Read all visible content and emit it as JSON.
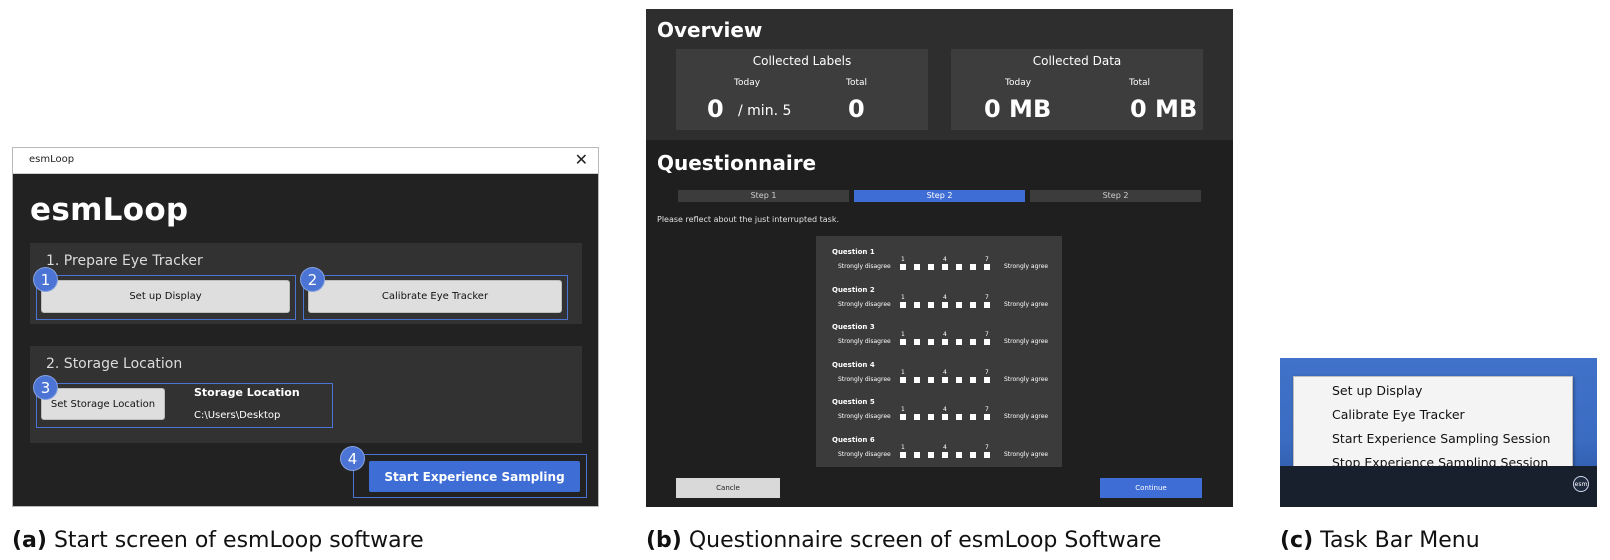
{
  "start_screen": {
    "window_title": "esmLoop",
    "close_glyph": "✕",
    "app_title": "esmLoop",
    "section1_title": "1. Prepare Eye Tracker",
    "setup_display_btn": "Set up Display",
    "calibrate_btn": "Calibrate Eye Tracker",
    "section2_title": "2. Storage Location",
    "set_storage_btn": "Set Storage Location",
    "storage_label": "Storage Location",
    "storage_path": "C:\\Users\\Desktop",
    "start_btn": "Start Experience Sampling",
    "badges": [
      "1",
      "2",
      "3",
      "4"
    ],
    "accent_color": "#4b74d4"
  },
  "questionnaire_screen": {
    "overview_title": "Overview",
    "labels_card": {
      "title": "Collected Labels",
      "today_label": "Today",
      "total_label": "Total",
      "today_value": "0",
      "today_suffix": "/ min. 5",
      "total_value": "0"
    },
    "data_card": {
      "title": "Collected Data",
      "today_label": "Today",
      "total_label": "Total",
      "today_value": "0 MB",
      "total_value": "0 MB"
    },
    "questionnaire_title": "Questionnaire",
    "steps": [
      "Step 1",
      "Step 2",
      "Step 2"
    ],
    "active_step_index": 1,
    "instruction": "Please reflect about the just interrupted task.",
    "questions": [
      {
        "title": "Question 1",
        "left": "Strongly disagree",
        "right": "Strongly agree"
      },
      {
        "title": "Question 2",
        "left": "Strongly disagree",
        "right": "Strongly agree"
      },
      {
        "title": "Question 3",
        "left": "Strongly disagree",
        "right": "Strongly agree"
      },
      {
        "title": "Question 4",
        "left": "Strongly disagree",
        "right": "Strongly agree"
      },
      {
        "title": "Question 5",
        "left": "Strongly disagree",
        "right": "Strongly agree"
      },
      {
        "title": "Question 6",
        "left": "Strongly disagree",
        "right": "Strongly agree"
      }
    ],
    "scale_labels": {
      "first": "1",
      "middle": "4",
      "last": "7"
    },
    "scale_points": 7,
    "cancel_btn": "Cancle",
    "continue_btn": "Continue"
  },
  "taskbar_menu": {
    "items": [
      "Set up Display",
      "Calibrate Eye Tracker",
      "Start Experience Sampling Session",
      "Stop Experience Sampling Session"
    ],
    "tray_icon_label": "esm"
  },
  "captions": [
    {
      "tag": "(a)",
      "text": "Start screen of esmLoop software"
    },
    {
      "tag": "(b)",
      "text": "Questionnaire screen of esmLoop Software"
    },
    {
      "tag": "(c)",
      "text": "Task Bar Menu"
    }
  ]
}
